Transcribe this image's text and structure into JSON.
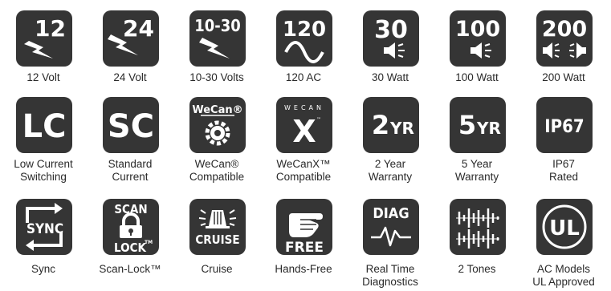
{
  "icons": [
    {
      "key": "12v",
      "tile_text": [
        "12"
      ],
      "label": [
        "12 Volt"
      ]
    },
    {
      "key": "24v",
      "tile_text": [
        "24"
      ],
      "label": [
        "24 Volt"
      ]
    },
    {
      "key": "10-30v",
      "tile_text": [
        "10-30"
      ],
      "label": [
        "10-30 Volts"
      ]
    },
    {
      "key": "120ac",
      "tile_text": [
        "120"
      ],
      "label": [
        "120 AC"
      ]
    },
    {
      "key": "30w",
      "tile_text": [
        "30"
      ],
      "label": [
        "30 Watt"
      ]
    },
    {
      "key": "100w",
      "tile_text": [
        "100"
      ],
      "label": [
        "100 Watt"
      ]
    },
    {
      "key": "200w",
      "tile_text": [
        "200"
      ],
      "label": [
        "200 Watt"
      ]
    },
    {
      "key": "lc",
      "tile_text": [
        "LC"
      ],
      "label": [
        "Low Current",
        "Switching"
      ]
    },
    {
      "key": "sc",
      "tile_text": [
        "SC"
      ],
      "label": [
        "Standard",
        "Current"
      ]
    },
    {
      "key": "wecan",
      "tile_text": [
        "WeCan®"
      ],
      "label": [
        "WeCan®",
        "Compatible"
      ]
    },
    {
      "key": "wecanx",
      "tile_text": [
        "WECAN",
        "X",
        "™"
      ],
      "label": [
        "WeCanX™",
        "Compatible"
      ]
    },
    {
      "key": "2yr",
      "tile_text": [
        "2",
        "YR"
      ],
      "label": [
        "2 Year",
        "Warranty"
      ]
    },
    {
      "key": "5yr",
      "tile_text": [
        "5",
        "YR"
      ],
      "label": [
        "5 Year",
        "Warranty"
      ]
    },
    {
      "key": "ip67",
      "tile_text": [
        "IP67"
      ],
      "label": [
        "IP67",
        "Rated"
      ]
    },
    {
      "key": "sync",
      "tile_text": [
        "SYNC"
      ],
      "label": [
        "Sync"
      ]
    },
    {
      "key": "scanlock",
      "tile_text": [
        "SCAN",
        "LOCK",
        "TM"
      ],
      "label": [
        "Scan-Lock™"
      ]
    },
    {
      "key": "cruise",
      "tile_text": [
        "CRUISE"
      ],
      "label": [
        "Cruise"
      ]
    },
    {
      "key": "handsfree",
      "tile_text": [
        "FREE"
      ],
      "label": [
        "Hands-Free"
      ]
    },
    {
      "key": "diag",
      "tile_text": [
        "DIAG"
      ],
      "label": [
        "Real Time",
        "Diagnostics"
      ]
    },
    {
      "key": "2tones",
      "tile_text": [],
      "label": [
        "2 Tones"
      ]
    },
    {
      "key": "ul",
      "tile_text": [
        "UL"
      ],
      "label": [
        "AC Models",
        "UL Approved"
      ]
    }
  ],
  "colors": {
    "tile": "#353535",
    "text": "#2a2a2a",
    "glyph": "#ffffff"
  }
}
